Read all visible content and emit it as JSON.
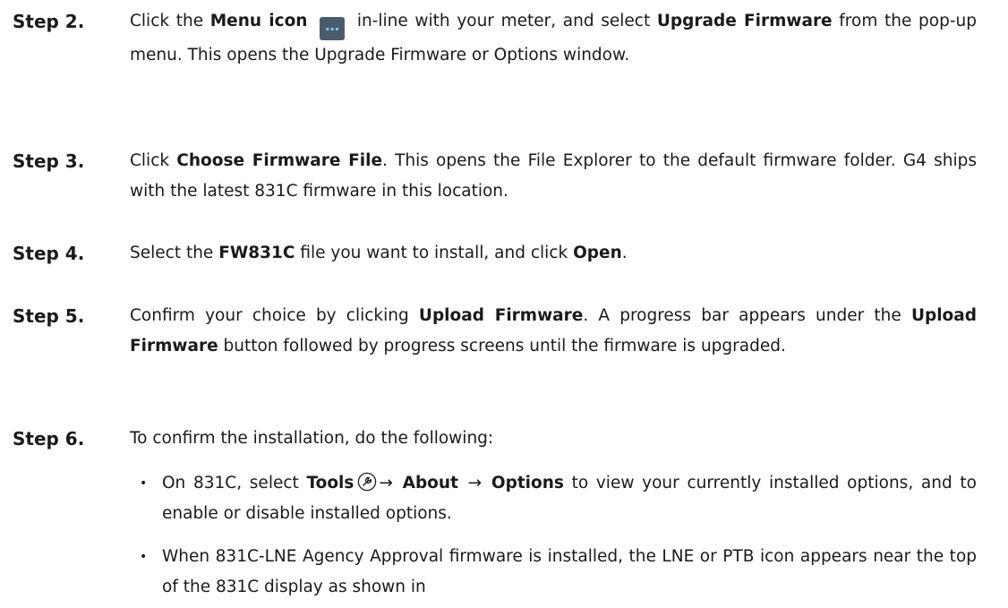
{
  "steps": [
    {
      "label": "Step 2.",
      "t1": "Click the ",
      "b1": "Menu icon",
      "t2": " in-line with your meter, and select ",
      "b2": "Upgrade Firmware",
      "t3": " from the pop-up menu. This opens the Upgrade Firmware or Options window.",
      "menu_icon_glyph": "…"
    },
    {
      "label": "Step 3.",
      "t1": "Click ",
      "b1": "Choose Firmware File",
      "t2": ". This opens the File Explorer to the default firmware folder. G4 ships with the latest 831C firmware in this location."
    },
    {
      "label": "Step 4.",
      "t1": "Select the ",
      "b1": "FW831C",
      "t2": " file you want to install, and click ",
      "b2": "Open",
      "t3": "."
    },
    {
      "label": "Step 5.",
      "t1": "Confirm your choice by clicking ",
      "b1": "Upload Firmware",
      "t2": ". A progress bar appears under the ",
      "b2": "Upload Firmware",
      "t3": " button followed by progress screens until the firmware is upgraded."
    },
    {
      "label": "Step 6.",
      "t1": "To confirm the installation, do the following:"
    }
  ],
  "bullets": [
    {
      "dot": "•",
      "t1": "On 831C, select ",
      "b1": "Tools",
      "arrow1": "→",
      "b2": "About",
      "arrow2": "→",
      "b3": "Options",
      "t2": " to view your currently installed options, and to enable or disable installed options."
    },
    {
      "dot": "•",
      "t1": "When 831C-LNE Agency Approval firmware is installed, the LNE or PTB icon appears near the top of the 831C display as shown in"
    }
  ],
  "icons": {
    "menu": "menu-icon",
    "tools": "wrench-icon"
  },
  "colors": {
    "menu_icon_bg": "#4a5b6b",
    "menu_icon_dots": "#7fc4ff"
  }
}
